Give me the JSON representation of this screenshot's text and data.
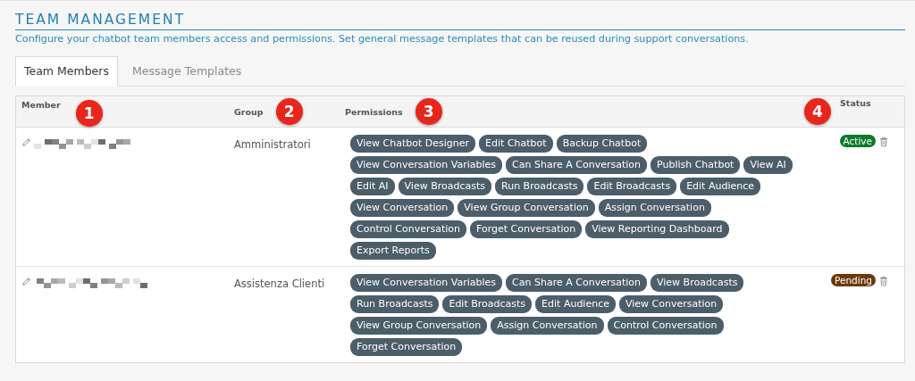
{
  "title": "TEAM MANAGEMENT",
  "subtitle": "Configure your chatbot team members access and permissions. Set general message templates that can be reused during support conversations.",
  "tabs": [
    {
      "label": "Team Members",
      "selected": true
    },
    {
      "label": "Message Templates",
      "selected": false
    }
  ],
  "table": {
    "columns": [
      {
        "label": "Member",
        "marker": "1"
      },
      {
        "label": "Group",
        "marker": "2"
      },
      {
        "label": "Permissions",
        "marker": "3"
      },
      {
        "label": "Status",
        "marker": "4"
      }
    ],
    "rows": [
      {
        "group": "Amministratori",
        "permissions": [
          "View Chatbot Designer",
          "Edit Chatbot",
          "Backup Chatbot",
          "View Conversation Variables",
          "Can Share A Conversation",
          "Publish Chatbot",
          "View AI",
          "Edit AI",
          "View Broadcasts",
          "Run Broadcasts",
          "Edit Broadcasts",
          "Edit Audience",
          "View Conversation",
          "View Group Conversation",
          "Assign Conversation",
          "Control Conversation",
          "Forget Conversation",
          "View Reporting Dashboard",
          "Export Reports"
        ],
        "status": {
          "label": "Active",
          "color": "#0c7a2a"
        }
      },
      {
        "group": "Assistenza Clienti",
        "permissions": [
          "View Conversation Variables",
          "Can Share A Conversation",
          "View Broadcasts",
          "Run Broadcasts",
          "Edit Broadcasts",
          "Edit Audience",
          "View Conversation",
          "View Group Conversation",
          "Assign Conversation",
          "Control Conversation",
          "Forget Conversation"
        ],
        "status": {
          "label": "Pending",
          "color": "#6b3a0c"
        }
      }
    ]
  }
}
